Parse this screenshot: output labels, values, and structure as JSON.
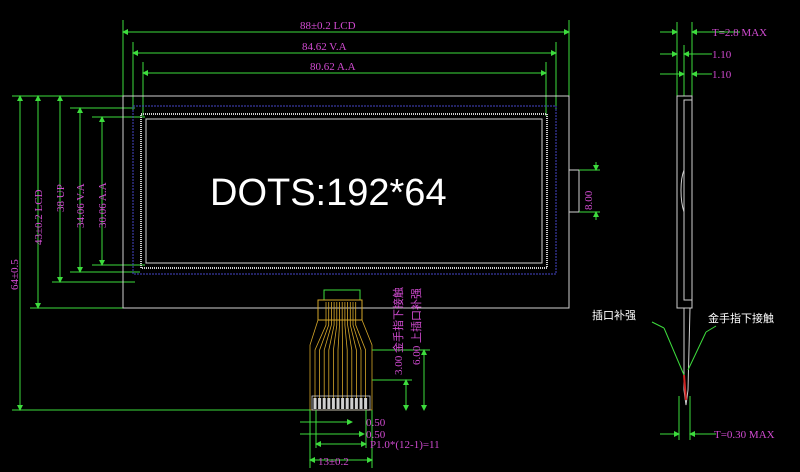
{
  "display": {
    "dots_label": "DOTS:192*64"
  },
  "dimensions": {
    "width_lcd": "88±0.2 LCD",
    "width_va": "84.62 V.A",
    "width_aa": "80.62 A.A",
    "height_total": "64±0.5",
    "height_lcd": "43±0.2 LCD",
    "height_up": "38 UP",
    "height_va": "34.06 V.A",
    "height_aa": "30.06 A.A",
    "side_height": "8.00",
    "thickness_max": "T=2.8 MAX",
    "layer_1": "1.10",
    "layer_2": "1.10",
    "fpc_thickness": "T=0.30 MAX",
    "gold_finger_offset": "3.00 金手指下接触",
    "stiffener_offset": "6.00 上插口补强",
    "pad_1": "0.50",
    "pad_2": "0.50",
    "pitch": "P1.0*(12-1)=11",
    "fpc_width": "13±0.2"
  },
  "callouts": {
    "stiffener": "插口补强",
    "gold_finger": "金手指下接触"
  },
  "colors": {
    "dimension_text": "#d24bd2",
    "dimension_line": "#3ddc3d",
    "outline": "#cfcfcf",
    "fpc": "#d4a62a"
  }
}
